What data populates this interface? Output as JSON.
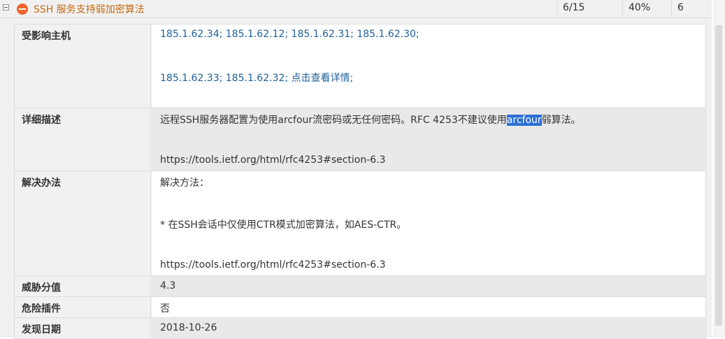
{
  "header": {
    "vuln_title": "SSH 服务支持弱加密算法",
    "count": "6/15",
    "percent": "40%",
    "number": "6"
  },
  "rows": {
    "hosts": {
      "label": "受影响主机",
      "line1": "185.1.62.34; 185.1.62.12; 185.1.62.31; 185.1.62.30;",
      "line2_hosts": "185.1.62.33; 185.1.62.32;",
      "line2_link": "点击查看详情;"
    },
    "description": {
      "label": "详细描述",
      "text_before": "远程SSH服务器配置为使用arcfour流密码或无任何密码。RFC 4253不建议使用",
      "text_selected": "arcfour",
      "text_after": "弱算法。",
      "url": "https://tools.ietf.org/html/rfc4253#section-6.3"
    },
    "solution": {
      "label": "解决办法",
      "heading": "解决方法：",
      "step": "* 在SSH会话中仅使用CTR模式加密算法，如AES-CTR。",
      "url": "https://tools.ietf.org/html/rfc4253#section-6.3"
    },
    "score": {
      "label": "威胁分值",
      "value": "4.3"
    },
    "plugin": {
      "label": "危险插件",
      "value": "否"
    },
    "date": {
      "label": "发现日期",
      "value": "2018-10-26"
    }
  }
}
